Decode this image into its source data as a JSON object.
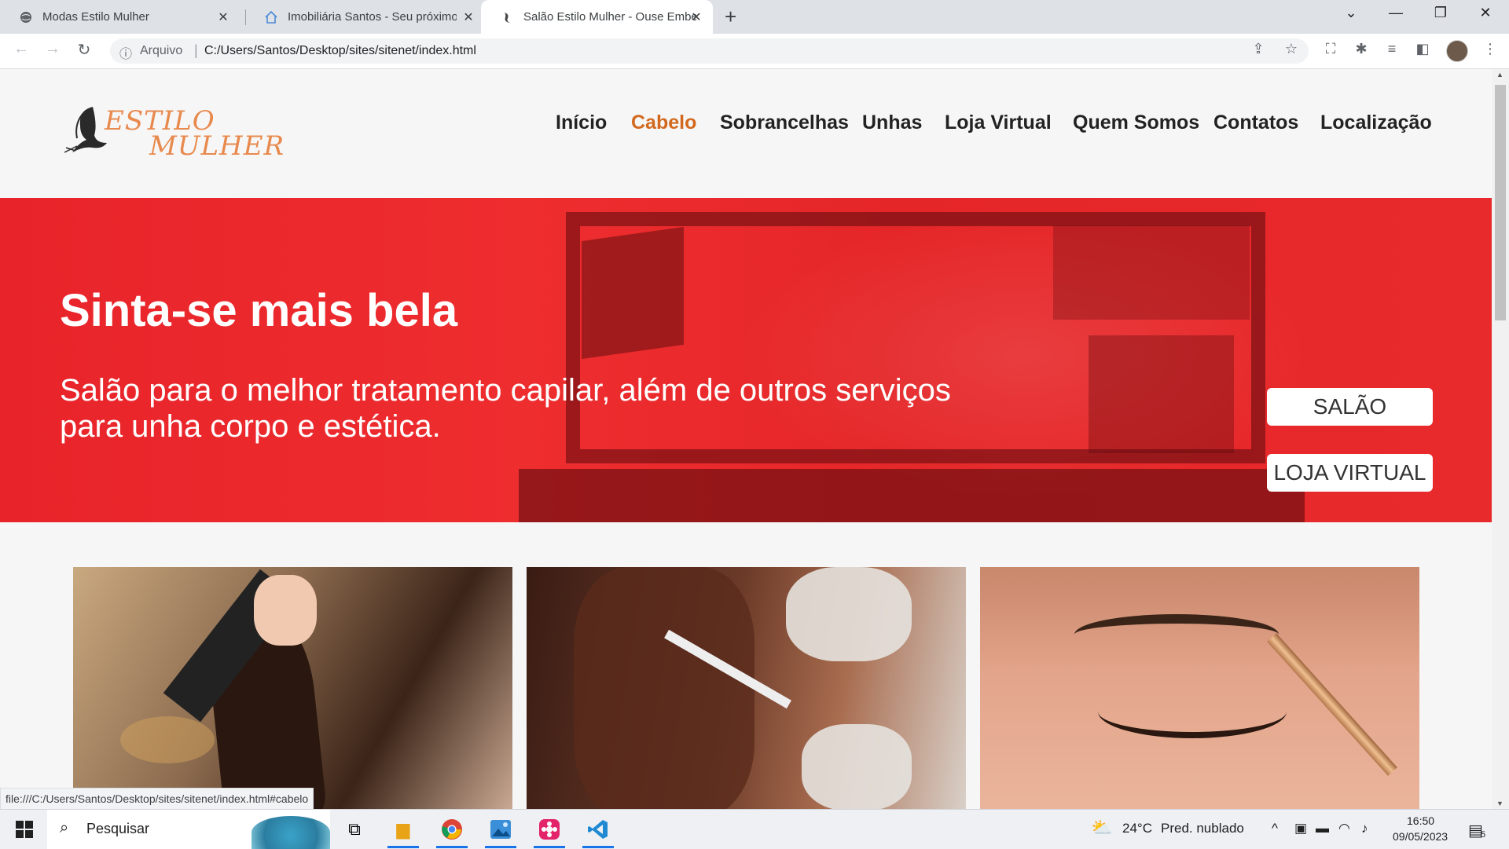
{
  "browser": {
    "tabs": [
      {
        "title": "Modas Estilo Mulher",
        "icon": "globe-icon",
        "active": false
      },
      {
        "title": "Imobiliária Santos - Seu próximo",
        "icon": "house-icon",
        "active": false
      },
      {
        "title": "Salão Estilo Mulher - Ouse Embel",
        "icon": "salon-favicon-icon",
        "active": true
      }
    ],
    "address": {
      "scheme_label": "Arquivo",
      "url": "C:/Users/Santos/Desktop/sites/sitenet/index.html"
    },
    "status_url": "file:///C:/Users/Santos/Desktop/sites/sitenet/index.html#cabelo"
  },
  "site": {
    "logo": {
      "line1": "ESTILO",
      "line2": "MULHER"
    },
    "nav": [
      {
        "label": "Início",
        "active": false
      },
      {
        "label": "Cabelo",
        "active": true
      },
      {
        "label": "Sobrancelhas",
        "active": false
      },
      {
        "label": "Unhas",
        "active": false
      },
      {
        "label": "Loja Virtual",
        "active": false
      },
      {
        "label": "Quem Somos",
        "active": false
      },
      {
        "label": "Contatos",
        "active": false
      },
      {
        "label": "Localização",
        "active": false
      }
    ],
    "hero": {
      "title": "Sinta-se mais bela",
      "subtitle": "Salão para o melhor tratamento capilar, além de outros serviços para unha corpo e estética.",
      "buttons": [
        "SALÃO",
        "LOJA VIRTUAL"
      ]
    },
    "cards": [
      {
        "subject": "haircut-photo"
      },
      {
        "subject": "hair-coloring-photo"
      },
      {
        "subject": "eyebrow-makeup-photo"
      }
    ],
    "colors": {
      "accent": "#d2691e",
      "hero": "#e8242a",
      "logo": "#e8894d"
    }
  },
  "taskbar": {
    "search_placeholder": "Pesquisar",
    "weather": {
      "temp": "24°C",
      "condition": "Pred. nublado"
    },
    "clock": {
      "time": "16:50",
      "date": "09/05/2023"
    },
    "notifications": "5"
  }
}
